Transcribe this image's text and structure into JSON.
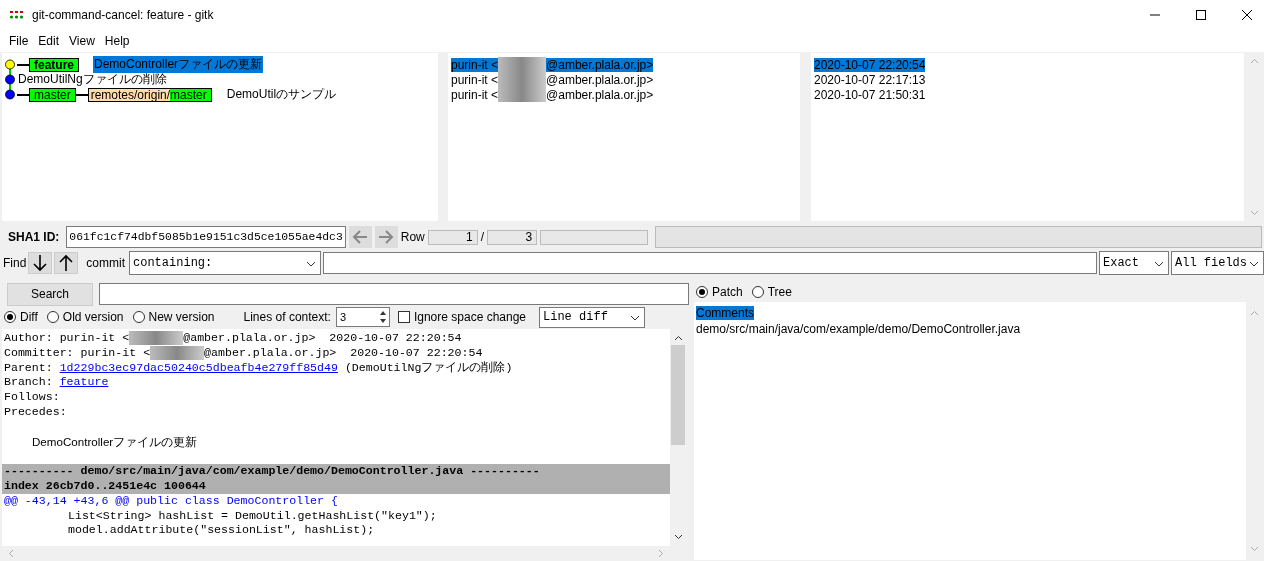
{
  "window": {
    "title": "git-command-cancel: feature - gitk"
  },
  "menu": [
    "File",
    "Edit",
    "View",
    "Help"
  ],
  "commits": [
    {
      "color": "#ffff00",
      "selected": true,
      "refs": [
        {
          "kind": "head",
          "label": "feature"
        }
      ],
      "message": "DemoControllerファイルの更新",
      "author": "purin-it <",
      "domain": "@amber.plala.or.jp>",
      "date": "2020-10-07 22:20:54"
    },
    {
      "color": "#0000ff",
      "selected": false,
      "message": "DemoUtilNgファイルの削除",
      "author": "purin-it <",
      "domain": "@amber.plala.or.jp>",
      "date": "2020-10-07 22:17:13"
    },
    {
      "color": "#0000ff",
      "selected": false,
      "refs": [
        {
          "kind": "local",
          "label": "master"
        },
        {
          "kind": "remote",
          "prefix": "remotes/origin/",
          "label": "master"
        }
      ],
      "message": "DemoUtilのサンプル",
      "author": "purin-it <",
      "domain": "@amber.plala.or.jp>",
      "date": "2020-10-07 21:50:31"
    }
  ],
  "sha": {
    "label": "SHA1 ID:",
    "value": "061fc1cf74dbf5085b1e9151c3d5ce1055ae4dc3",
    "row_label": "Row",
    "row": "1",
    "separator": "/",
    "total": "3"
  },
  "progress": {
    "level": 0
  },
  "find": {
    "label": "Find",
    "type_label": "commit",
    "mode": "containing:",
    "match": "Exact",
    "fields": "All fields"
  },
  "search": {
    "button": "Search"
  },
  "diff_options": {
    "radios": [
      {
        "label": "Diff",
        "selected": true
      },
      {
        "label": "Old version",
        "selected": false
      },
      {
        "label": "New version",
        "selected": false
      }
    ],
    "context_label": "Lines of context:",
    "context": "3",
    "ignore_space": {
      "label": "Ignore space change",
      "checked": false
    },
    "diff_mode": "Line diff"
  },
  "diff_lines": [
    {
      "kind": "person",
      "text": "Author: purin-it <",
      "rest": "@amber.plala.or.jp>  2020-10-07 22:20:54"
    },
    {
      "kind": "person",
      "text": "Committer: purin-it <",
      "rest": "@amber.plala.or.jp>  2020-10-07 22:20:54"
    },
    {
      "kind": "link",
      "text": "Parent:",
      "link": "1d229bc3ec97dac50240c5dbeafb4e279ff85d49",
      "rest": "(DemoUtilNgファイルの削除)"
    },
    {
      "kind": "link",
      "text": "Branch:",
      "link": "feature"
    },
    {
      "kind": "plain",
      "text": "Follows:"
    },
    {
      "kind": "plain",
      "text": "Precedes:"
    },
    {
      "kind": "blank"
    },
    {
      "kind": "message",
      "text": "DemoControllerファイルの更新"
    },
    {
      "kind": "blank"
    },
    {
      "kind": "file",
      "text": "---------- demo/src/main/java/com/example/demo/DemoController.java ----------"
    },
    {
      "kind": "file",
      "text": "index 26cb7d0..2451e4c 100644"
    },
    {
      "kind": "hunk",
      "text": "@@ -43,14 +43,6 @@ public class DemoController {"
    },
    {
      "kind": "code",
      "text": "List<String> hashList = DemoUtil.getHashList(\"key1\");"
    },
    {
      "kind": "code",
      "text": "model.addAttribute(\"sessionList\", hashList);"
    }
  ],
  "view_radios": [
    {
      "label": "Patch",
      "selected": true
    },
    {
      "label": "Tree",
      "selected": false
    }
  ],
  "files": [
    {
      "label": "Comments",
      "selected": true
    },
    {
      "label": "demo/src/main/java/com/example/demo/DemoController.java",
      "selected": false
    }
  ]
}
